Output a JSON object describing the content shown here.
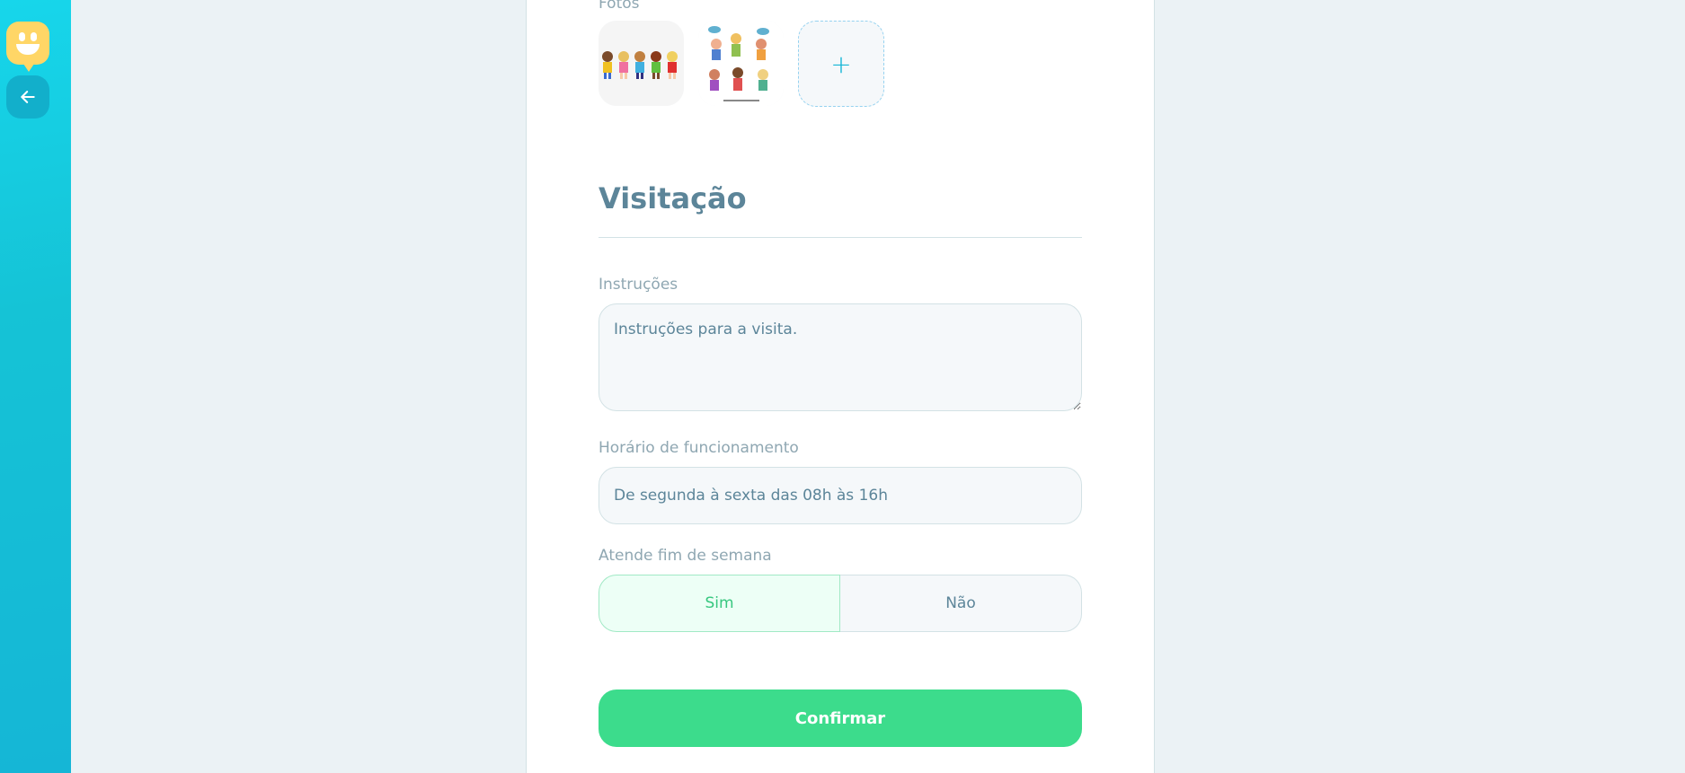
{
  "sidebar": {
    "logo_icon": "happy-face-logo-icon",
    "back_icon": "arrow-left-icon"
  },
  "form": {
    "photos_label": "Fotos",
    "add_photo_label": "+",
    "section_title": "Visitação",
    "instructions": {
      "label": "Instruções",
      "value": "Instruções para a visita."
    },
    "opening_hours": {
      "label": "Horário de funcionamento",
      "value": "De segunda à sexta das 08h às 16h"
    },
    "open_on_weekends": {
      "label": "Atende fim de semana",
      "yes_label": "Sim",
      "no_label": "Não",
      "selected": "Sim"
    },
    "confirm_label": "Confirmar"
  },
  "colors": {
    "sidebar_gradient_start": "#17d6eb",
    "sidebar_gradient_end": "#15b6d6",
    "logo": "#ffd666",
    "title": "#5c8599",
    "confirm": "#3cdc8c",
    "toggle_active_text": "#37c77f"
  }
}
